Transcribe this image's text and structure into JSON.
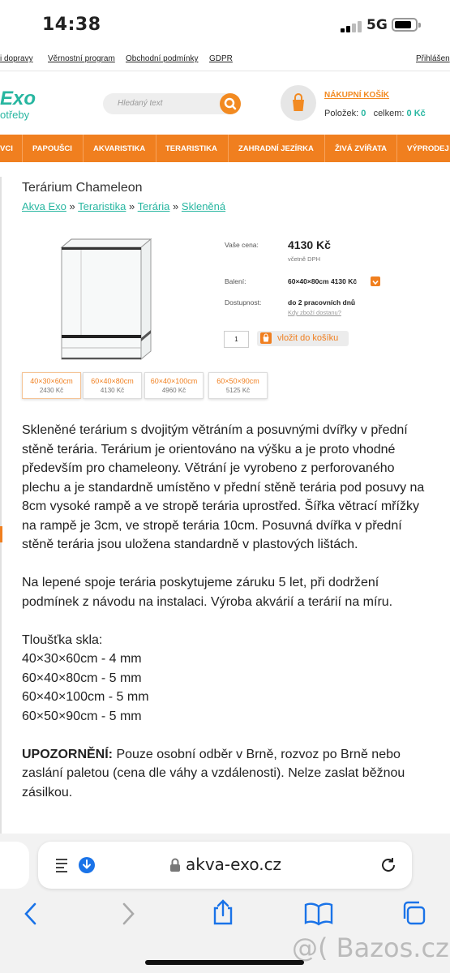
{
  "status": {
    "time": "14:38",
    "network": "5G"
  },
  "top_links": [
    "i dopravy",
    "Věrnostní program",
    "Obchodní podmínky",
    "GDPR",
    "Přihlášen"
  ],
  "logo": {
    "line1": "Exo",
    "line2": "otřeby"
  },
  "search": {
    "placeholder": "Hledaný text"
  },
  "cart": {
    "title": "NÁKUPNÍ KOŠÍK",
    "items_label": "Položek:",
    "items": "0",
    "total_label": "celkem:",
    "total": "0 Kč"
  },
  "menu": [
    "VCI",
    "PAPOUŠCI",
    "AKVARISTIKA",
    "TERARISTIKA",
    "ZAHRADNÍ JEZÍRKA",
    "ŽIVÁ ZVÍŘATA",
    "VÝPRODEJ"
  ],
  "product": {
    "title": "Terárium Chameleon",
    "breadcrumb": [
      "Akva Exo",
      "Teraristika",
      "Terária",
      "Skleněná"
    ],
    "breadcrumb_sep": "»",
    "price_label": "Vaše cena:",
    "price": "4130 Kč",
    "vat_note": "včetně DPH",
    "pack_label": "Balení:",
    "pack_value": "60×40×80cm    4130 Kč",
    "avail_label": "Dostupnost:",
    "avail_value": "do 2 pracovních dnů",
    "avail_link": "Kdy zboží dostanu?",
    "qty": "1",
    "add_to_cart": "vložit do košíku",
    "variants": [
      {
        "dim": "40×30×60cm",
        "price": "2430 Kč"
      },
      {
        "dim": "60×40×80cm",
        "price": "4130 Kč"
      },
      {
        "dim": "60×40×100cm",
        "price": "4960 Kč"
      },
      {
        "dim": "60×50×90cm",
        "price": "5125 Kč"
      }
    ]
  },
  "description": {
    "p1": "Skleněné terárium s dvojitým větráním a posuvnými dvířky v přední stěně terária. Terárium je orientováno na výšku a je proto vhodné především pro chameleony. Větrání je vyrobeno z perforovaného plechu a je standardně umístěno v přední stěně terária pod posuvy na 8cm vysoké rampě a ve stropě terária uprostřed. Šířka větrací mřížky na rampě je 3cm, ve stropě terária 10cm. Posuvná dvířka v přední stěně terária jsou uložena standardně v plastových lištách.",
    "p2": "Na lepené spoje terária poskytujeme záruku 5 let, při dodržení podmínek z návodu na instalaci. Výroba akvárií a terárií na míru.",
    "thickness_title": "Tloušťka skla:",
    "thickness": [
      "40×30×60cm - 4 mm",
      "60×40×80cm - 5 mm",
      "60×40×100cm - 5 mm",
      "60×50×90cm - 5 mm"
    ],
    "warning_label": "UPOZORNĚNÍ:",
    "warning_text": " Pouze osobní odběr v Brně, rozvoz po Brně nebo zaslání paletou (cena dle váhy a vzdálenosti). Nelze zaslat běžnou zásilkou."
  },
  "browser": {
    "url": "akva-exo.cz"
  },
  "watermark": "@( Bazos.cz",
  "colors": {
    "accent": "#f07f1f",
    "brand": "#27b6a0"
  }
}
